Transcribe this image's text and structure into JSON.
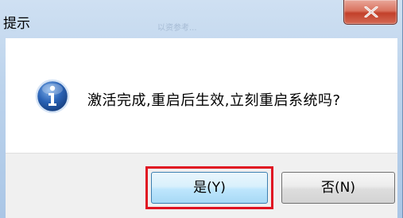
{
  "window": {
    "title": "提示",
    "background_ghost_text": "以资参考..."
  },
  "dialog": {
    "icon": "info-icon",
    "message": "激活完成,重启后生效,立刻重启系统吗?"
  },
  "buttons": {
    "yes_label": "是(Y)",
    "no_label": "否(N)",
    "close_icon": "close-icon"
  },
  "colors": {
    "highlight_border": "#e01422",
    "close_button": "#c2402a",
    "info_icon_blue": "#2a63b6"
  }
}
